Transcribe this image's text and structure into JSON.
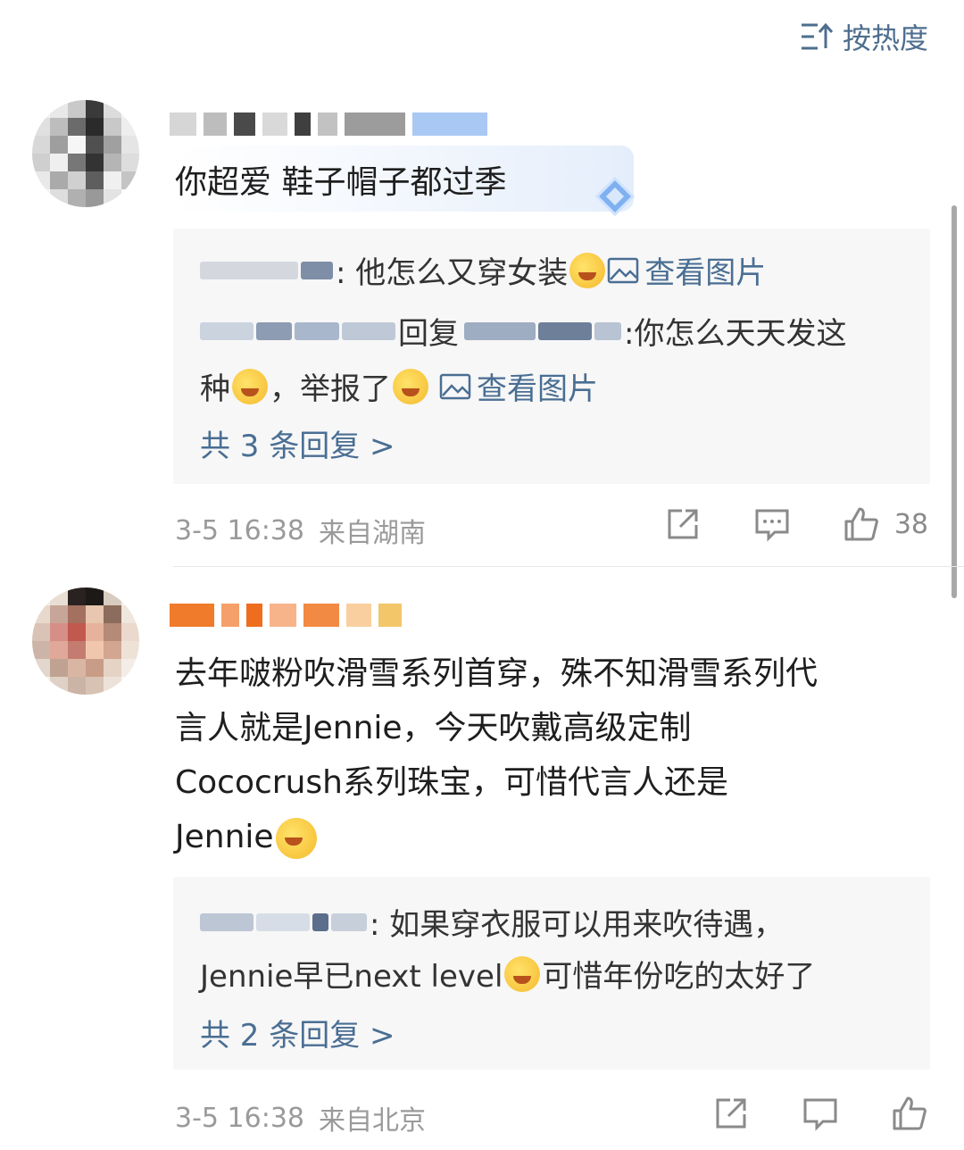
{
  "sort": {
    "label": "按热度"
  },
  "comments": [
    {
      "text": "你超爱 鞋子帽子都过季",
      "replies": [
        {
          "name_blurred": true,
          "text": ": 他怎么又穿女装",
          "view_image": "查看图片"
        },
        {
          "text_a": "回复",
          "text_b": ":你怎么天天发这",
          "text_c": "种",
          "text_d": "，举报了",
          "view_image": "查看图片"
        }
      ],
      "more_replies": "共 3 条回复 >",
      "time": "3-5 16:38",
      "location": "来自湖南",
      "likes": "38"
    },
    {
      "text_lines": [
        "去年啵粉吹滑雪系列首穿，殊不知滑雪系列代",
        "言人就是Jennie，今天吹戴高级定制",
        "Cococrush系列珠宝，可惜代言人还是",
        "Jennie"
      ],
      "replies": [
        {
          "text": ": 如果穿衣服可以用来吹待遇，",
          "text2": "Jennie早已next level",
          "text3": "可惜年份吃的太好了"
        }
      ],
      "more_replies": "共 2 条回复 >",
      "time": "3-5 16:38",
      "location": "来自北京"
    }
  ],
  "colors": {
    "link": "#4a6e93",
    "meta": "#9a9a9a",
    "reply_bg": "#f7f7f7"
  },
  "icons": [
    "sort-icon",
    "image-icon",
    "share-icon",
    "comment-icon",
    "like-icon",
    "diamond-badge-icon",
    "emoji-icon"
  ]
}
